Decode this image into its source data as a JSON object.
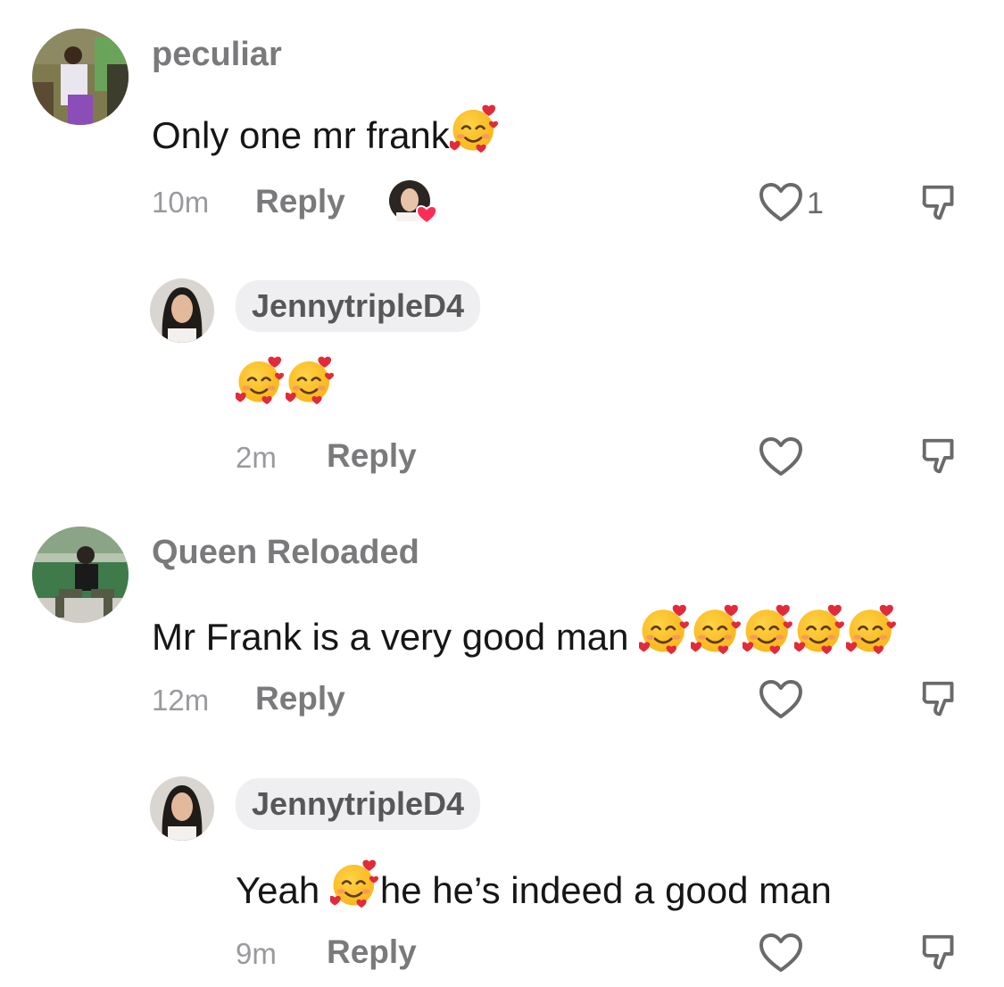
{
  "comments": [
    {
      "username": "peculiar",
      "text": "Only one mr frank",
      "emoji_count": 1,
      "time": "10m",
      "reply_label": "Reply",
      "likes": "1",
      "liked_by_creator": true
    },
    {
      "username": "JennytripleD4",
      "text": "",
      "emoji_count": 2,
      "time": "2m",
      "reply_label": "Reply",
      "likes": ""
    },
    {
      "username": "Queen Reloaded",
      "text": "Mr Frank is a very good man ",
      "emoji_count": 5,
      "time": "12m",
      "reply_label": "Reply",
      "likes": ""
    },
    {
      "username": "JennytripleD4",
      "text_before": "Yeah ",
      "text_after": "he he’s indeed a good man",
      "time": "9m",
      "reply_label": "Reply",
      "likes": ""
    }
  ],
  "icons": {
    "heart": "heart-outline-icon",
    "dislike": "thumbs-down-icon",
    "emoji": "smiling-face-with-hearts"
  },
  "colors": {
    "text": "#161616",
    "muted": "#7a7a7c",
    "heart_badge": "#fe2c55"
  }
}
